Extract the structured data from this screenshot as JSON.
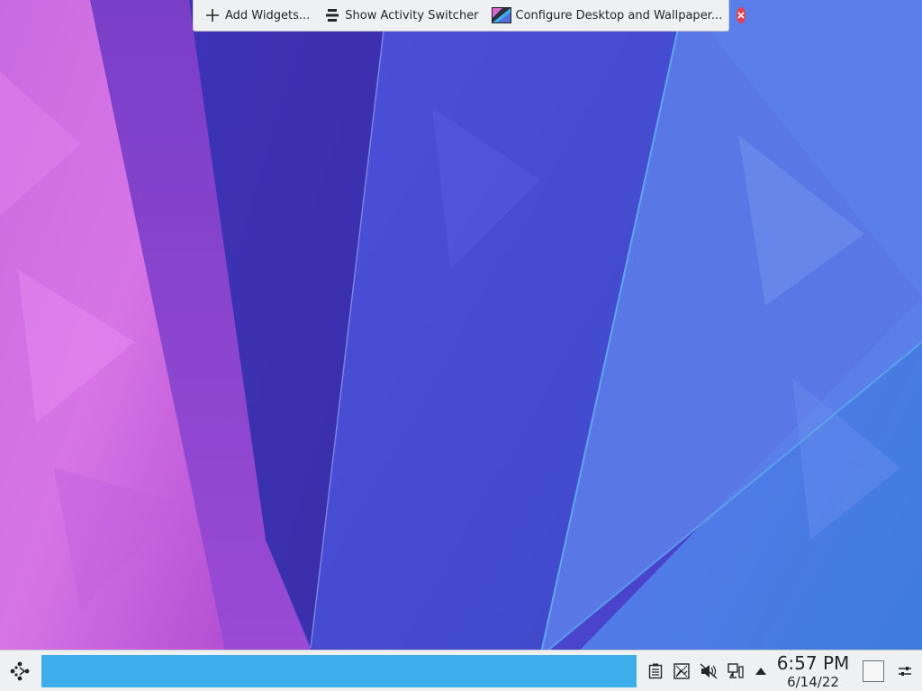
{
  "toolbar": {
    "add_widgets": "Add Widgets...",
    "show_activity_switcher": "Show Activity Switcher",
    "configure_desktop": "Configure Desktop and Wallpaper..."
  },
  "taskbar": {
    "accent": "#3daee9",
    "tray_icons": [
      "clipboard-icon",
      "screenshot-icon",
      "volume-muted-icon",
      "network-icon",
      "expand-tray-icon"
    ]
  },
  "clock": {
    "time": "6:57 PM",
    "date": "6/14/22"
  },
  "colors": {
    "panel_bg": "#eff0f1",
    "close_red": "#e5414f"
  }
}
